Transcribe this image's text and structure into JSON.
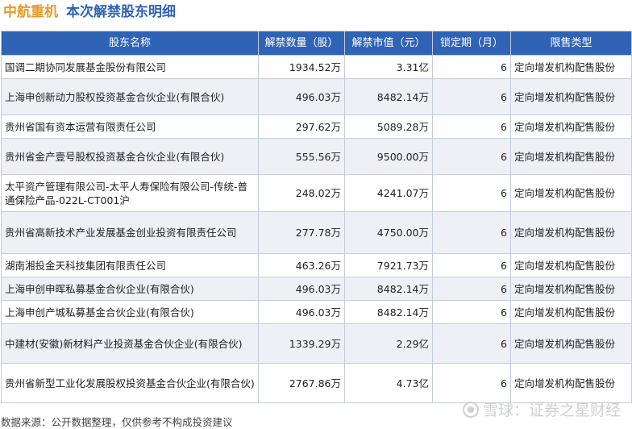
{
  "header": {
    "company": "中航重机",
    "subject": "本次解禁股东明细"
  },
  "table": {
    "columns": [
      "股东名称",
      "解禁数量（股）",
      "解禁市值（元）",
      "锁定期（月）",
      "限售类型"
    ],
    "rows": [
      {
        "name": "国调二期协同发展基金股份有限公司",
        "qty": "1934.52万",
        "value": "3.31亿",
        "lock": "6",
        "type": "定向增发机构配售股份"
      },
      {
        "name": "上海申创新动力股权投资基金合伙企业(有限合伙)",
        "qty": "496.03万",
        "value": "8482.14万",
        "lock": "6",
        "type": "定向增发机构配售股份"
      },
      {
        "name": "贵州省国有资本运营有限责任公司",
        "qty": "297.62万",
        "value": "5089.28万",
        "lock": "6",
        "type": "定向增发机构配售股份"
      },
      {
        "name": "贵州省金产壹号股权投资基金合伙企业(有限合伙)",
        "qty": "555.56万",
        "value": "9500.00万",
        "lock": "6",
        "type": "定向增发机构配售股份"
      },
      {
        "name": "太平资产管理有限公司-太平人寿保险有限公司-传统-普通保险产品-022L-CT001沪",
        "qty": "248.02万",
        "value": "4241.07万",
        "lock": "6",
        "type": "定向增发机构配售股份"
      },
      {
        "name": "贵州省高新技术产业发展基金创业投资有限责任公司",
        "qty": "277.78万",
        "value": "4750.00万",
        "lock": "6",
        "type": "定向增发机构配售股份"
      },
      {
        "name": "湖南湘投金天科技集团有限责任公司",
        "qty": "463.26万",
        "value": "7921.73万",
        "lock": "6",
        "type": "定向增发机构配售股份"
      },
      {
        "name": "上海申创申晖私募基金合伙企业(有限合伙)",
        "qty": "496.03万",
        "value": "8482.14万",
        "lock": "6",
        "type": "定向增发机构配售股份"
      },
      {
        "name": "上海申创产城私募基金合伙企业(有限合伙)",
        "qty": "496.03万",
        "value": "8482.14万",
        "lock": "6",
        "type": "定向增发机构配售股份"
      },
      {
        "name": "中建材(安徽)新材料产业投资基金合伙企业(有限合伙)",
        "qty": "1339.29万",
        "value": "2.29亿",
        "lock": "6",
        "type": "定向增发机构配售股份"
      },
      {
        "name": "贵州省新型工业化发展股权投资基金合伙企业(有限合伙)",
        "qty": "2767.86万",
        "value": "4.73亿",
        "lock": "6",
        "type": "定向增发机构配售股份"
      }
    ]
  },
  "footer": {
    "source": "数据来源：公开数据整理，仅供参考不构成投资建议"
  },
  "watermark": {
    "text": "雪球：证券之星财经",
    "icon": "snowball-logo-icon"
  }
}
